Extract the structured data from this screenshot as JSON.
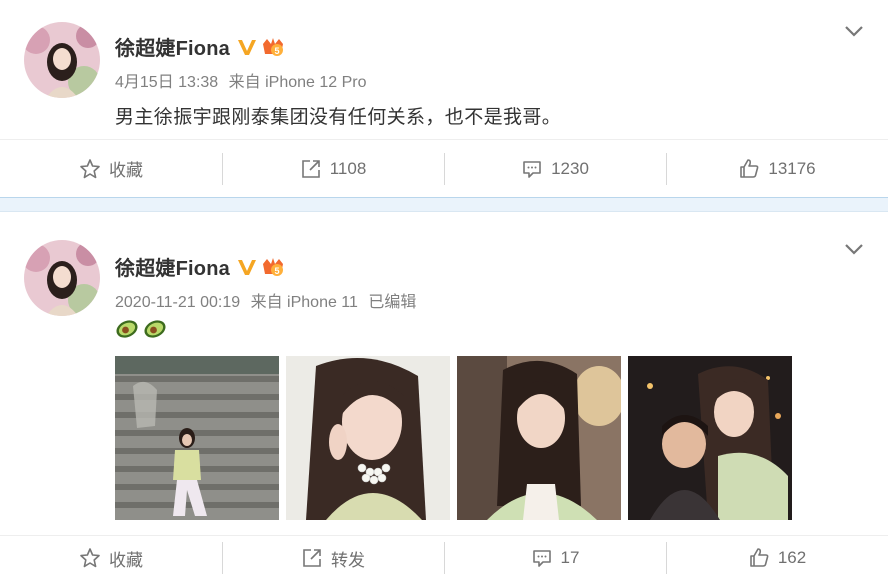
{
  "posts": [
    {
      "username": "徐超婕Fiona",
      "timestamp": "4月15日 13:38",
      "source": "来自 iPhone 12 Pro",
      "edited": "",
      "text": "男主徐振宇跟刚泰集团没有任何关系，也不是我哥。",
      "emojis": [],
      "photos": [],
      "actions": {
        "favorite": "收藏",
        "repost": "1108",
        "comment": "1230",
        "like": "13176"
      }
    },
    {
      "username": "徐超婕Fiona",
      "timestamp": "2020-11-21 00:19",
      "source": "来自 iPhone 11",
      "edited": "已编辑",
      "text": "",
      "emojis": [
        "avocado-emoji",
        "avocado-emoji"
      ],
      "photos": [
        "photo-stairs",
        "photo-selfie-pearl",
        "photo-selfie-lamp",
        "photo-with-boy"
      ],
      "actions": {
        "favorite": "收藏",
        "repost": "转发",
        "comment": "17",
        "like": "162"
      }
    }
  ],
  "colors": {
    "text_primary": "#333333",
    "text_secondary": "#808080",
    "verified_gold": "#f5a623",
    "level_orange": "#f26a2e",
    "divider_band": "#eaf3fb"
  },
  "icons": {
    "favorite": "star-icon",
    "repost": "share-arrow-icon",
    "comment": "comment-bubble-icon",
    "like": "thumbs-up-icon",
    "menu": "chevron-down-icon"
  }
}
